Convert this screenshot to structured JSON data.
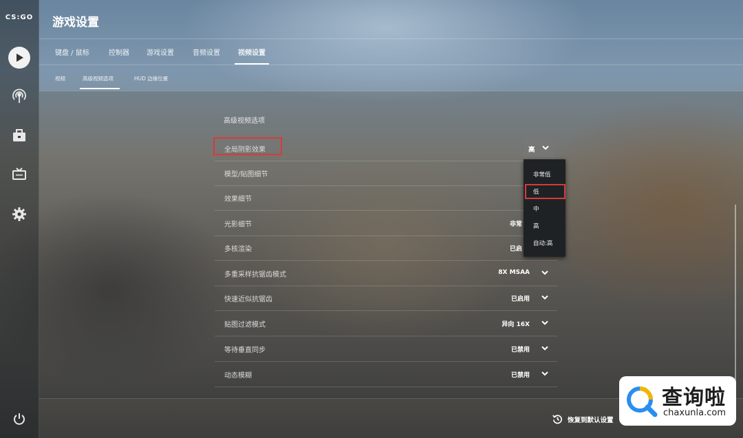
{
  "app": {
    "logo_text": "CS:GO"
  },
  "page": {
    "title": "游戏设置"
  },
  "tabs": [
    {
      "label": "键盘 / 鼠标"
    },
    {
      "label": "控制器"
    },
    {
      "label": "游戏设置"
    },
    {
      "label": "音频设置"
    },
    {
      "label": "视频设置",
      "active": true
    }
  ],
  "subtabs": [
    {
      "label": "视频"
    },
    {
      "label": "高级视频选项",
      "active": true
    },
    {
      "label": "HUD 边缘位置"
    }
  ],
  "section": {
    "title": "高级视频选项"
  },
  "settings": [
    {
      "label": "全局阴影效果",
      "value": "高"
    },
    {
      "label": "模型/贴图细节",
      "value": ""
    },
    {
      "label": "效果细节",
      "value": ""
    },
    {
      "label": "光影细节",
      "value": "非常"
    },
    {
      "label": "多核渲染",
      "value": "已启"
    },
    {
      "label": "多重采样抗锯齿模式",
      "value": "8X MSAA"
    },
    {
      "label": "快速近似抗锯齿",
      "value": "已启用"
    },
    {
      "label": "贴图过滤模式",
      "value": "异向 16X"
    },
    {
      "label": "等待垂直同步",
      "value": "已禁用"
    },
    {
      "label": "动态模糊",
      "value": "已禁用"
    }
  ],
  "dropdown": {
    "options": [
      "非常低",
      "低",
      "中",
      "高",
      "自动:高"
    ],
    "highlighted": "低"
  },
  "footer": {
    "restore_label": "恢复到默认设置"
  },
  "watermark": {
    "title": "查询啦",
    "subtitle": "chaxunla.com"
  },
  "colors": {
    "highlight_border": "#d93a3a",
    "dropdown_bg": "#1f2225"
  },
  "icons": [
    "play-icon",
    "broadcast-icon",
    "briefcase-icon",
    "tv-icon",
    "gear-icon",
    "power-icon",
    "chevron-down-icon",
    "restore-icon",
    "search-logo-icon"
  ]
}
